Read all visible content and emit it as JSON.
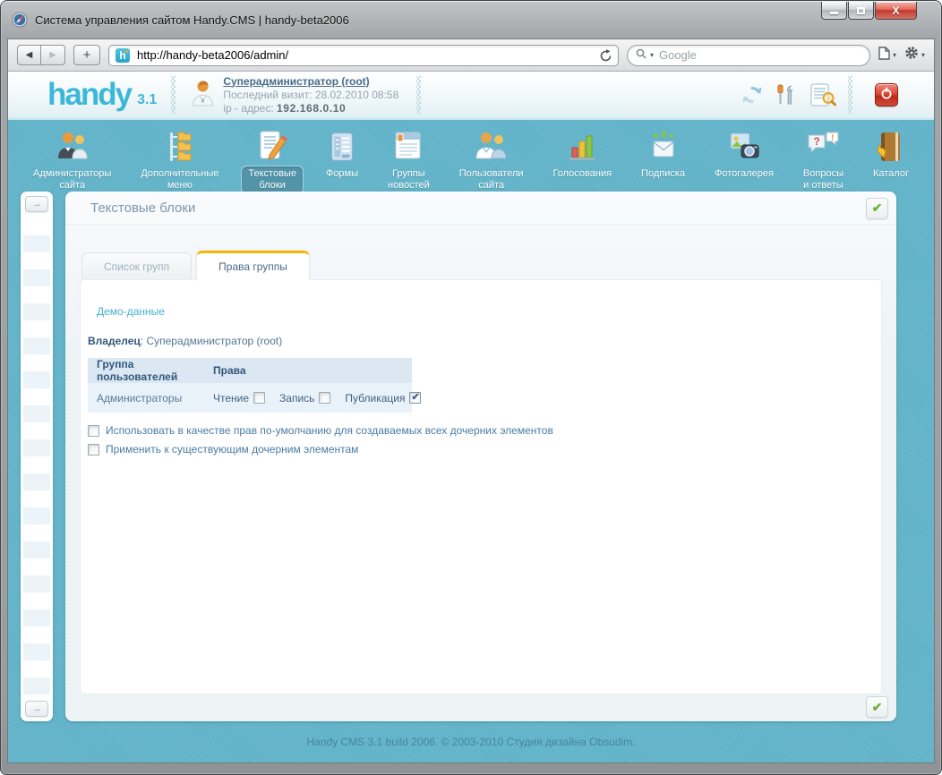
{
  "window": {
    "title": "Система управления сайтом Handy.CMS | handy-beta2006"
  },
  "browser": {
    "url": "http://handy-beta2006/admin/",
    "search_placeholder": "Google"
  },
  "header": {
    "logo": "handy",
    "version": "3.1",
    "user_link": "Суперадминистратор (root)",
    "last_visit": "Последний визит: 28.02.2010 08:58",
    "ip_label": "ip - адрес: ",
    "ip_value": "192.168.0.10"
  },
  "nav": {
    "items": [
      {
        "label": "Администраторы сайта",
        "selected": false
      },
      {
        "label": "Дополнительные меню",
        "selected": false
      },
      {
        "label": "Текстовые блоки",
        "selected": true
      },
      {
        "label": "Формы",
        "selected": false
      },
      {
        "label": "Группы новостей",
        "selected": false
      },
      {
        "label": "Пользователи сайта",
        "selected": false
      },
      {
        "label": "Голосования",
        "selected": false
      },
      {
        "label": "Подписка",
        "selected": false
      },
      {
        "label": "Фотогалерея",
        "selected": false
      },
      {
        "label": "Вопросы и ответы",
        "selected": false
      },
      {
        "label": "Каталог",
        "selected": false
      }
    ]
  },
  "panel": {
    "title": "Текстовые блоки",
    "tabs": [
      {
        "label": "Список групп",
        "active": false
      },
      {
        "label": "Права группы",
        "active": true
      }
    ],
    "demo_link": "Демо-данные",
    "owner_label": "Владелец",
    "owner_value": ": Суперадминистратор (root)",
    "table": {
      "col_group": "Группа пользователей",
      "col_rights": "Права",
      "group_name": "Администраторы",
      "permissions": [
        {
          "label": "Чтение",
          "checked": false
        },
        {
          "label": "Запись",
          "checked": false
        },
        {
          "label": "Публикация",
          "checked": true
        }
      ]
    },
    "options": [
      {
        "label": "Использовать в качестве прав по-умолчанию для создаваемых всех дочерних элементов",
        "checked": false
      },
      {
        "label": "Применить к существующим дочерним элементам",
        "checked": false
      }
    ]
  },
  "footer": {
    "text": "Handy CMS 3.1 build 2006. © 2003-2010 Студия дизайна Obsudim."
  },
  "colors": {
    "teal_bg": "#61b4ca",
    "tab_accent": "#f5b700",
    "link_blue": "#48b0d4",
    "check_green": "#6db33c",
    "power_red": "#d9402f"
  }
}
